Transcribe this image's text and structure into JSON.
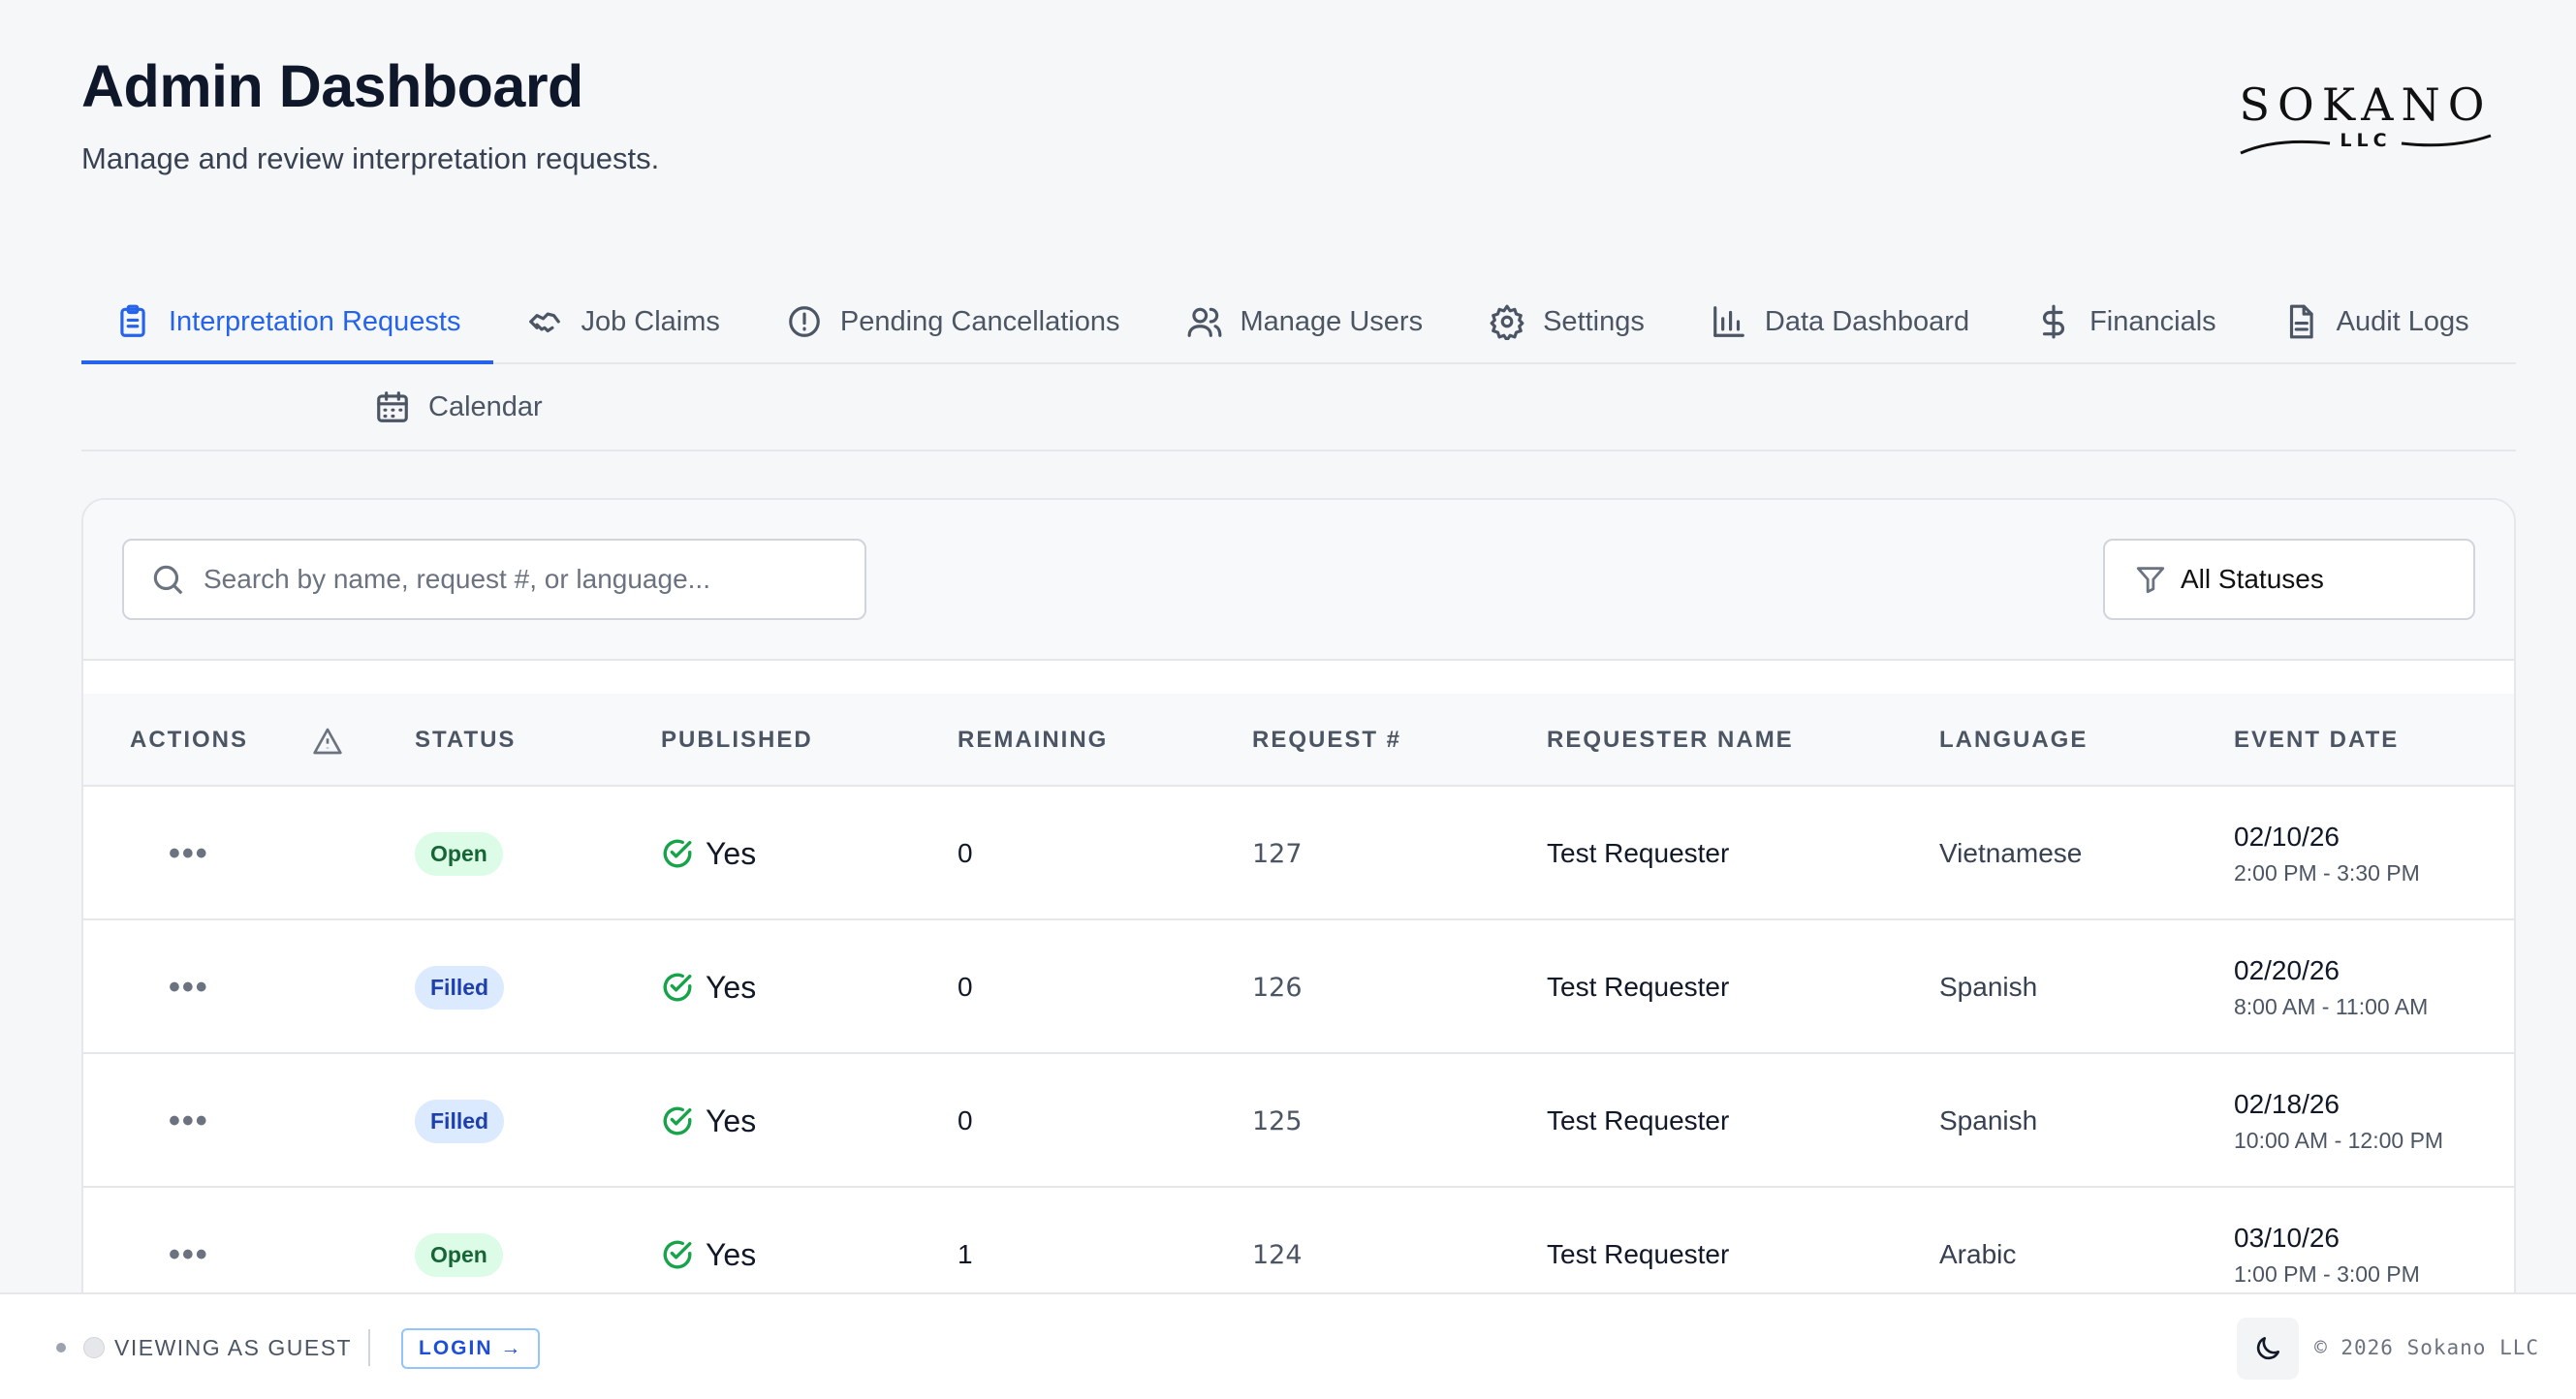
{
  "header": {
    "title": "Admin Dashboard",
    "subtitle": "Manage and review interpretation requests.",
    "logo_main": "SOKANO",
    "logo_sub": "LLC"
  },
  "tabs": [
    {
      "label": "Interpretation Requests",
      "icon": "clipboard-icon",
      "active": true
    },
    {
      "label": "Job Claims",
      "icon": "handshake-icon"
    },
    {
      "label": "Pending Cancellations",
      "icon": "alert-circle-icon"
    },
    {
      "label": "Manage Users",
      "icon": "users-icon"
    },
    {
      "label": "Settings",
      "icon": "gear-icon"
    },
    {
      "label": "Data Dashboard",
      "icon": "bar-chart-icon"
    },
    {
      "label": "Financials",
      "icon": "dollar-icon"
    },
    {
      "label": "Audit Logs",
      "icon": "document-icon"
    },
    {
      "label": "Calendar",
      "icon": "calendar-icon"
    }
  ],
  "search": {
    "placeholder": "Search by name, request #, or language..."
  },
  "status_filter": {
    "value": "All Statuses"
  },
  "table": {
    "columns": [
      "ACTIONS",
      "",
      "STATUS",
      "PUBLISHED",
      "REMAINING",
      "REQUEST #",
      "REQUESTER NAME",
      "LANGUAGE",
      "EVENT DATE"
    ],
    "rows": [
      {
        "actions": "•••",
        "status": "Open",
        "published": "Yes",
        "remaining": "0",
        "request": "127",
        "requester": "Test Requester",
        "language": "Vietnamese",
        "date": "02/10/26",
        "time": "2:00 PM - 3:30 PM"
      },
      {
        "actions": "•••",
        "status": "Filled",
        "published": "Yes",
        "remaining": "0",
        "request": "126",
        "requester": "Test Requester",
        "language": "Spanish",
        "date": "02/20/26",
        "time": "8:00 AM - 11:00 AM"
      },
      {
        "actions": "•••",
        "status": "Filled",
        "published": "Yes",
        "remaining": "0",
        "request": "125",
        "requester": "Test Requester",
        "language": "Spanish",
        "date": "02/18/26",
        "time": "10:00 AM - 12:00 PM"
      },
      {
        "actions": "•••",
        "status": "Open",
        "published": "Yes",
        "remaining": "1",
        "request": "124",
        "requester": "Test Requester",
        "language": "Arabic",
        "date": "03/10/26",
        "time": "1:00 PM - 3:00 PM"
      }
    ]
  },
  "footer": {
    "guest_label": "VIEWING AS GUEST",
    "login_label": "LOGIN →",
    "copyright": "© 2026 Sokano LLC"
  },
  "colors": {
    "accent": "#2563eb",
    "open_badge": "#dcfce7",
    "filled_badge": "#dbeafe",
    "check": "#16a34a"
  }
}
